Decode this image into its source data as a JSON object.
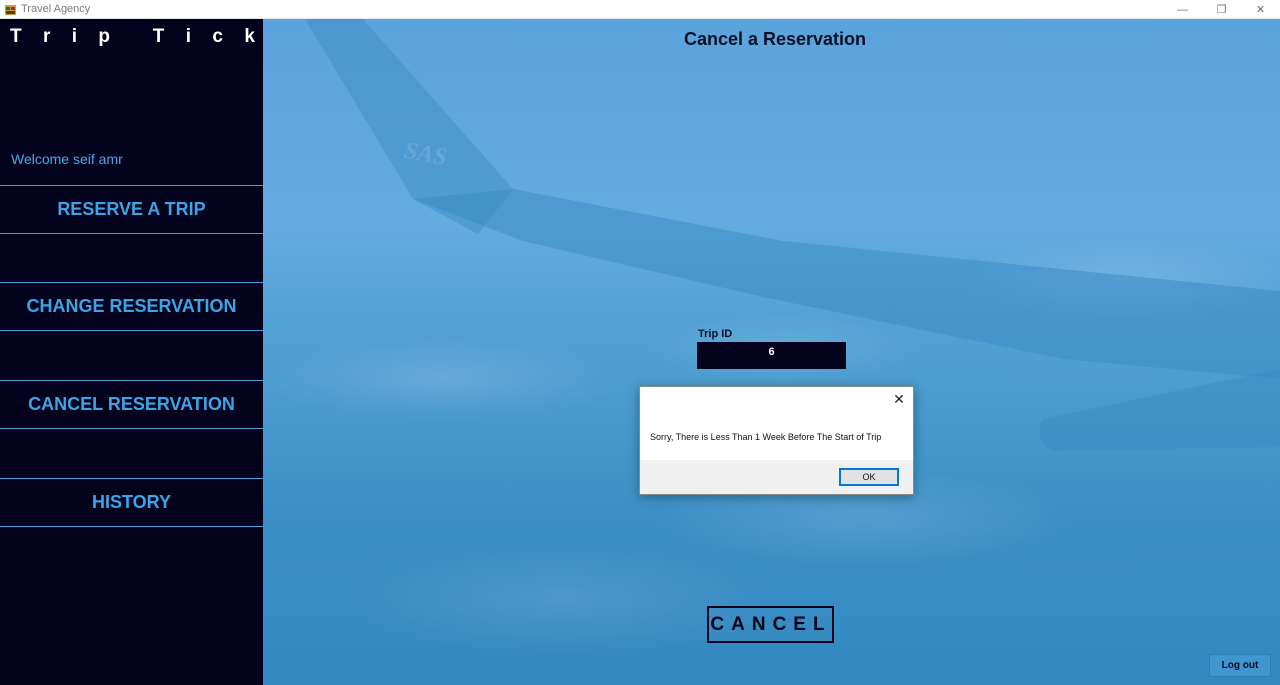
{
  "window": {
    "title": "Travel Agency",
    "icon": "app-icon",
    "controls": {
      "minimize": "—",
      "restore": "❐",
      "close": "✕"
    }
  },
  "sidebar": {
    "logo_letters": [
      "T",
      "r",
      "i",
      "p",
      "",
      "T",
      "i",
      "c",
      "k"
    ],
    "welcome": "Welcome seif amr",
    "items": [
      {
        "label": "RESERVE A TRIP"
      },
      {
        "label": "CHANGE RESERVATION"
      },
      {
        "label": "CANCEL RESERVATION"
      },
      {
        "label": "HISTORY"
      }
    ]
  },
  "main": {
    "title": "Cancel a Reservation",
    "wing_text": "SAS",
    "trip_id_label": "Trip ID",
    "trip_id_value": "6",
    "cancel_label": "CANCEL",
    "logout_label": "Log out"
  },
  "dialog": {
    "message": "Sorry, There is Less Than 1 Week Before The Start of Trip",
    "ok_label": "OK",
    "close_symbol": "✕"
  },
  "colors": {
    "sidebar_bg": "#03031d",
    "accent_blue": "#3fa4e6",
    "sky": "#5aa3dc"
  }
}
